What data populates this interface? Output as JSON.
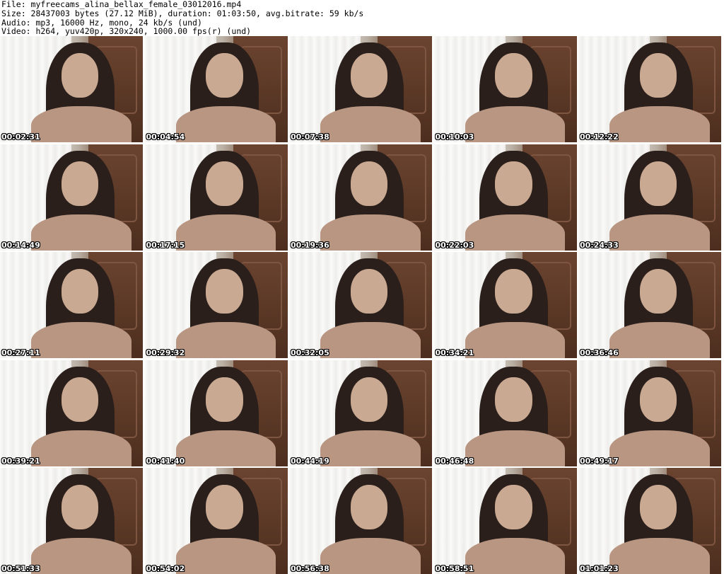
{
  "header": {
    "file": "File: myfreecams_alina_bellax_female_03012016.mp4",
    "size": "Size: 28437003 bytes (27.12 MiB), duration: 01:03:50, avg.bitrate: 59 kb/s",
    "audio": "Audio: mp3, 16000 Hz, mono, 24 kb/s (und)",
    "video": "Video: h264, yuv420p, 320x240, 1000.00 fps(r) (und)"
  },
  "thumbnails": [
    {
      "timestamp": "00:02:31"
    },
    {
      "timestamp": "00:04:54"
    },
    {
      "timestamp": "00:07:38"
    },
    {
      "timestamp": "00:10:03"
    },
    {
      "timestamp": "00:12:22"
    },
    {
      "timestamp": "00:14:49"
    },
    {
      "timestamp": "00:17:15"
    },
    {
      "timestamp": "00:19:36"
    },
    {
      "timestamp": "00:22:03"
    },
    {
      "timestamp": "00:24:33"
    },
    {
      "timestamp": "00:27:11"
    },
    {
      "timestamp": "00:29:32"
    },
    {
      "timestamp": "00:32:05"
    },
    {
      "timestamp": "00:34:21"
    },
    {
      "timestamp": "00:36:46"
    },
    {
      "timestamp": "00:39:21"
    },
    {
      "timestamp": "00:41:40"
    },
    {
      "timestamp": "00:44:19"
    },
    {
      "timestamp": "00:46:48"
    },
    {
      "timestamp": "00:49:17"
    },
    {
      "timestamp": "00:51:33"
    },
    {
      "timestamp": "00:54:02"
    },
    {
      "timestamp": "00:56:38"
    },
    {
      "timestamp": "00:58:51"
    },
    {
      "timestamp": "01:01:23"
    }
  ]
}
